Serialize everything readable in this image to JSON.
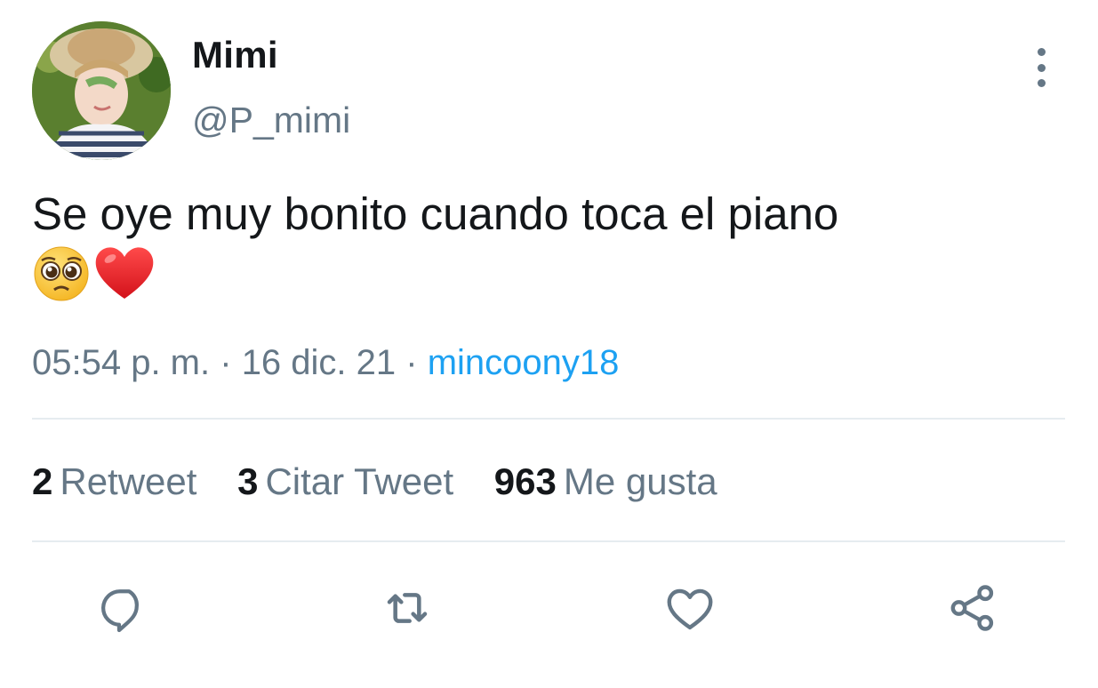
{
  "author": {
    "display_name": "Mimi",
    "handle": "@P_mimi"
  },
  "tweet": {
    "text": "Se oye muy bonito cuando toca el piano",
    "emojis": [
      "pleading-face-emoji",
      "red-heart-emoji"
    ]
  },
  "meta": {
    "time": "05:54 p. m.",
    "sep1": "·",
    "date": "16 dic. 21",
    "sep2": "·",
    "source": "mincoony18"
  },
  "stats": {
    "retweets": {
      "count": "2",
      "label": "Retweet"
    },
    "quotes": {
      "count": "3",
      "label": "Citar Tweet"
    },
    "likes": {
      "count": "963",
      "label": "Me gusta"
    }
  },
  "actions": [
    "reply-icon",
    "retweet-icon",
    "like-icon",
    "share-icon"
  ],
  "colors": {
    "text_primary": "#14171a",
    "text_secondary": "#657786",
    "link": "#1da1f2",
    "divider": "#e6ecf0"
  }
}
